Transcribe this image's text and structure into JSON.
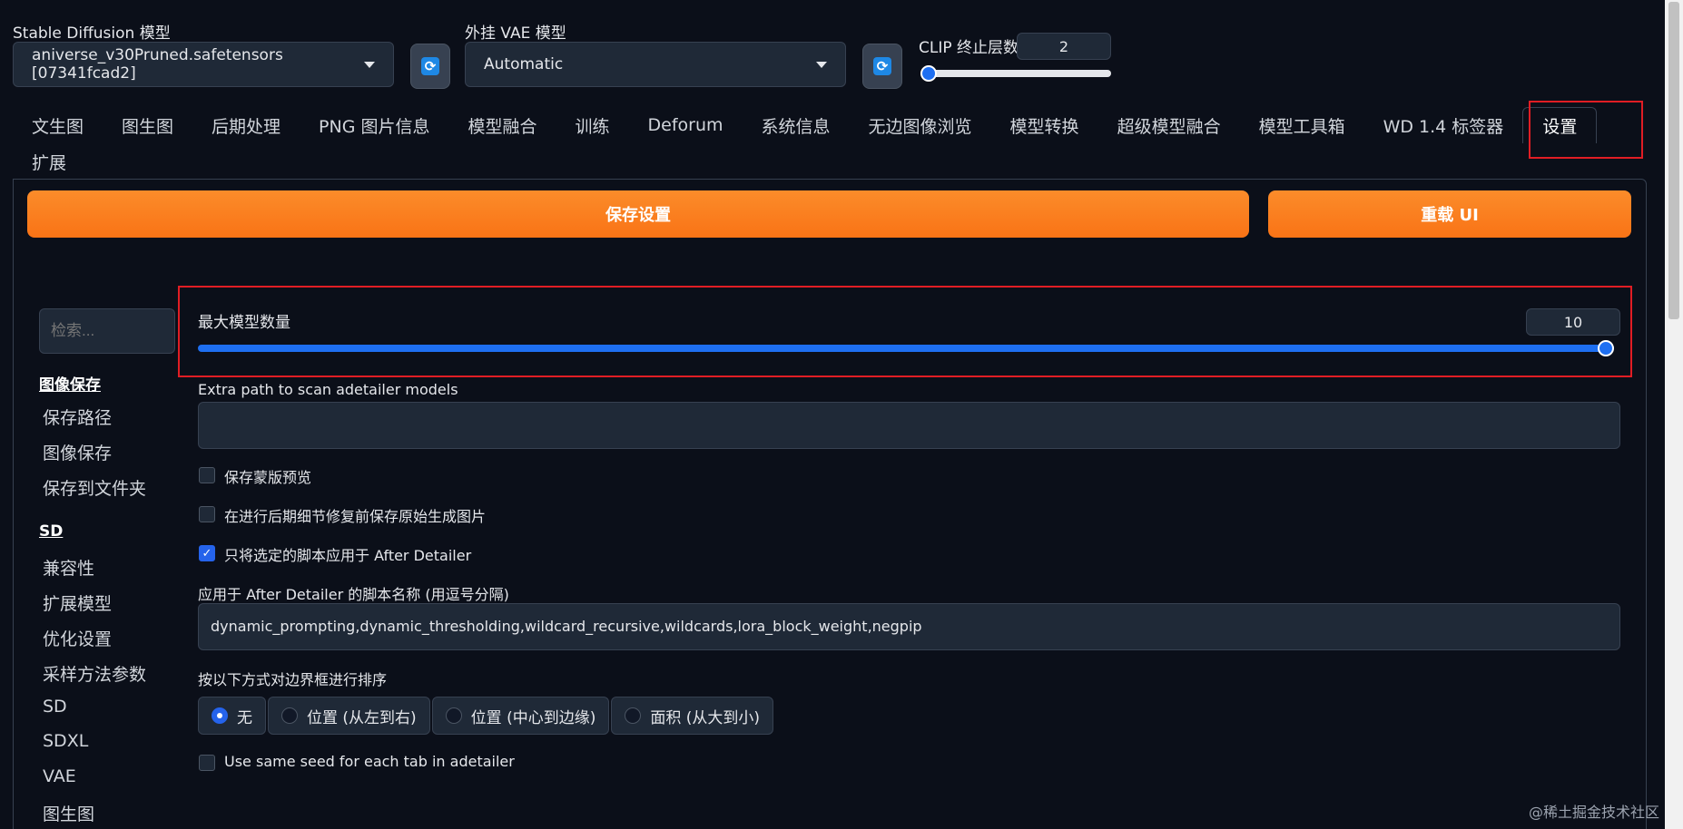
{
  "top": {
    "sd_model_label": "Stable Diffusion 模型",
    "sd_model_value": "aniverse_v30Pruned.safetensors [07341fcad2]",
    "vae_label": "外挂 VAE 模型",
    "vae_value": "Automatic",
    "clip_label": "CLIP 终止层数",
    "clip_value": "2",
    "clip_level": 0.0
  },
  "tabs": [
    "文生图",
    "图生图",
    "后期处理",
    "PNG 图片信息",
    "模型融合",
    "训练",
    "Deforum",
    "系统信息",
    "无边图像浏览",
    "模型转换",
    "超级模型融合",
    "模型工具箱",
    "WD 1.4 标签器",
    "设置",
    "扩展"
  ],
  "active_tab": "设置",
  "buttons": {
    "save_settings": "保存设置",
    "reload_ui": "重载 UI"
  },
  "sidebar": {
    "search_placeholder": "检索...",
    "section1_head": "图像保存",
    "section1_items": [
      "保存路径",
      "图像保存",
      "保存到文件夹"
    ],
    "section2_head": "SD",
    "section2_items": [
      "兼容性",
      "扩展模型",
      "优化设置",
      "采样方法参数",
      "SD",
      "SDXL",
      "VAE",
      "图生图"
    ]
  },
  "settings": {
    "max_models_label": "最大模型数量",
    "max_models_value": "10",
    "max_models_level": 1.0,
    "extra_path_label": "Extra path to scan adetailer models",
    "extra_path_value": "",
    "cb_save_mask_preview": "保存蒙版预览",
    "cb_save_before": "在进行后期细节修复前保存原始生成图片",
    "cb_only_selected": "只将选定的脚本应用于 After Detailer",
    "scripts_label": "应用于 After Detailer 的脚本名称 (用逗号分隔)",
    "scripts_value": "dynamic_prompting,dynamic_thresholding,wildcard_recursive,wildcards,lora_block_weight,negpip",
    "sort_label": "按以下方式对边界框进行排序",
    "sort_options": [
      "无",
      "位置 (从左到右)",
      "位置 (中心到边缘)",
      "面积 (从大到小)"
    ],
    "cb_same_seed": "Use same seed for each tab in adetailer"
  },
  "watermark": "@稀土掘金技术社区"
}
